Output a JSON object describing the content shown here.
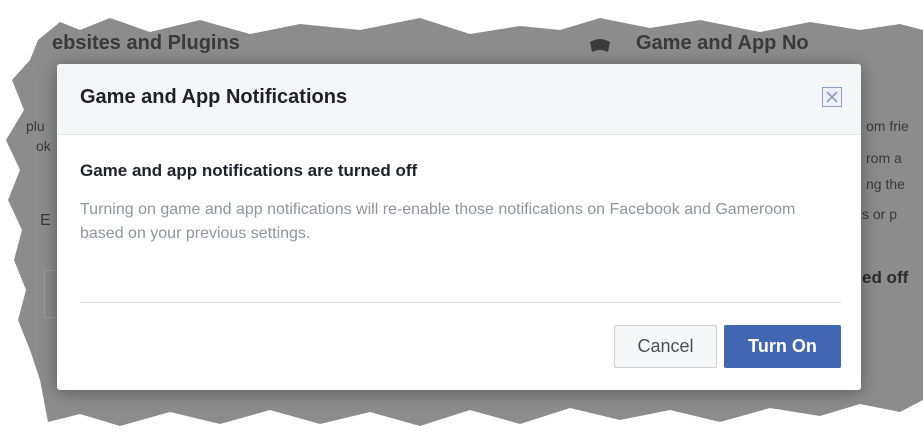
{
  "background": {
    "left_heading": "ebsites and Plugins",
    "right_heading": "Game and App No",
    "snippets_left": [
      "plu",
      "ok",
      "E"
    ],
    "snippets_right": [
      "om frie",
      "rom a",
      "ng the",
      "s or p"
    ],
    "right_status": "ed off"
  },
  "modal": {
    "title": "Game and App Notifications",
    "close_icon": "close-icon",
    "heading": "Game and app notifications are turned off",
    "description": "Turning on game and app notifications will re-enable those notifications on Facebook and Gameroom based on your previous settings.",
    "cancel_label": "Cancel",
    "turn_on_label": "Turn On"
  },
  "colors": {
    "primary_button": "#4267b2",
    "header_bg": "#f5f6f7",
    "backdrop": "#8c8c8c"
  }
}
